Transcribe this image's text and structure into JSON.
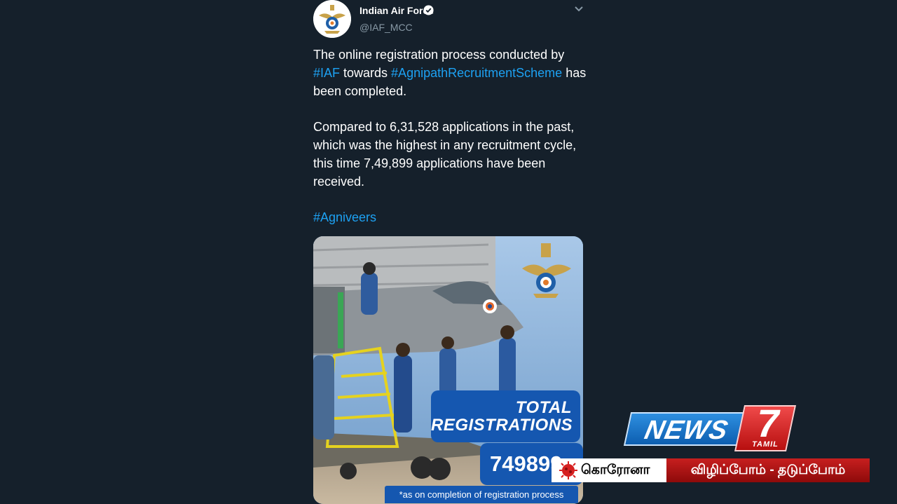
{
  "tweet": {
    "author_name": "Indian Air Force",
    "handle": "@IAF_MCC",
    "verified_icon": "verified-badge-icon",
    "menu_icon": "chevron-down-icon",
    "paragraph1": {
      "t1": "The online registration process conducted by ",
      "tag1": "#IAF",
      "t2": " towards ",
      "tag2": "#AgnipathRecruitmentScheme",
      "t3": " has been completed."
    },
    "paragraph2": "Compared to 6,31,528 applications in the past, which was the highest in any recruitment cycle, this time 7,49,899 applications have been received.",
    "hashtag": "#Agniveers",
    "media": {
      "headline_line1": "TOTAL",
      "headline_line2": "REGISTRATIONS",
      "count_visible": "749899",
      "footnote": "*as on completion of registration process",
      "emblem_icon": "iaf-emblem-icon"
    }
  },
  "overlay": {
    "logo_word": "NEWS",
    "logo_number": "7",
    "logo_sub": "TAMIL",
    "ticker_left": "கொரோனா",
    "ticker_right": "விழிப்போம் - தடுப்போம்",
    "virus_icon": "coronavirus-icon"
  },
  "colors": {
    "background": "#15202b",
    "link": "#1da1f2",
    "badge_blue": "#1557b0",
    "ticker_red": "#c71f1f"
  }
}
